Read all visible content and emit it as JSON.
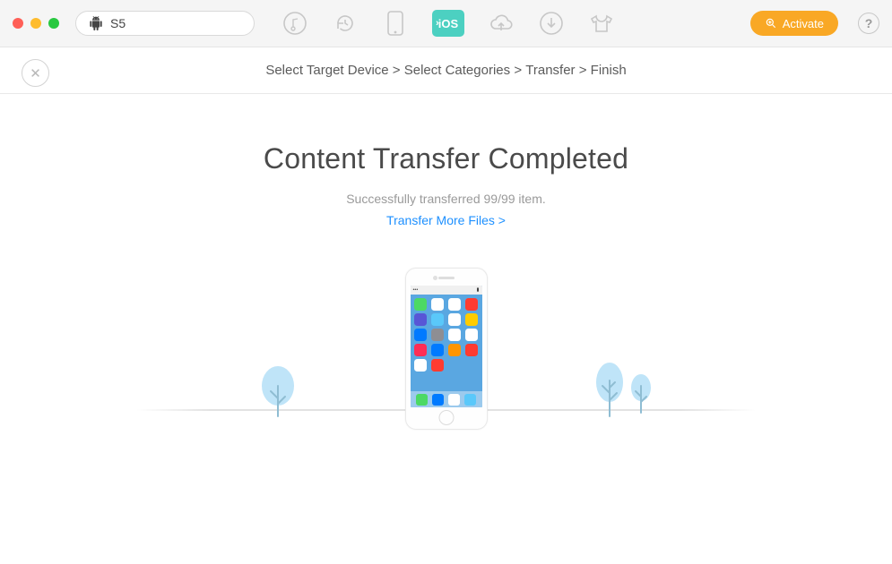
{
  "header": {
    "device_name": "S5",
    "activate_label": "Activate",
    "help_label": "?"
  },
  "breadcrumb": {
    "step1": "Select Target Device",
    "step2": "Select Categories",
    "step3": "Transfer",
    "step4": "Finish",
    "sep": ">"
  },
  "main": {
    "headline": "Content Transfer Completed",
    "subline": "Successfully transferred 99/99 item.",
    "more_link": "Transfer More Files >"
  },
  "icons": {
    "music": "music-icon",
    "history": "history-icon",
    "phone": "phone-icon",
    "ios": "iOS",
    "cloud": "cloud-icon",
    "download": "download-icon",
    "tshirt": "tshirt-icon",
    "search": "search-icon",
    "close": "✕",
    "android": "android-icon"
  },
  "colors": {
    "accent_teal": "#4cd0c1",
    "accent_orange": "#f9a825",
    "link_blue": "#1e90ff",
    "text_dark": "#4a4a4a",
    "text_muted": "#9a9a9a",
    "hairline": "#e5e5e5"
  }
}
